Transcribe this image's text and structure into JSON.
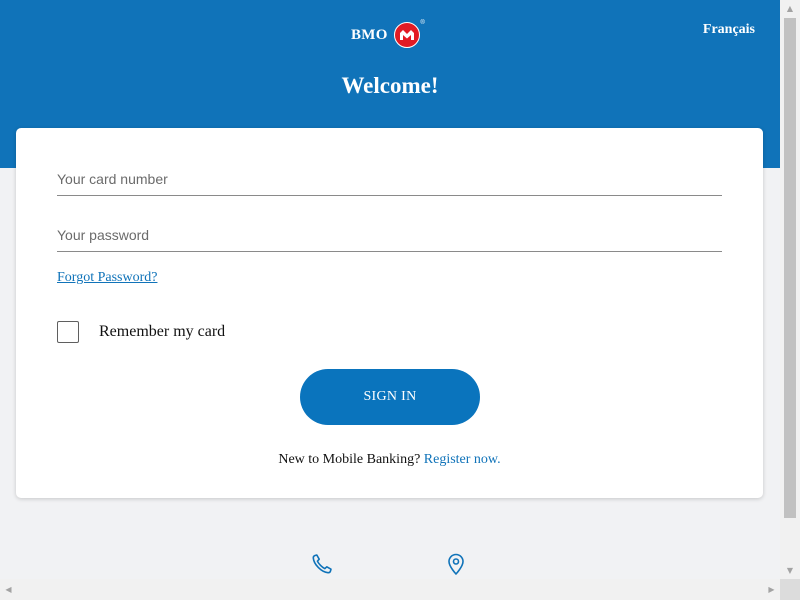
{
  "header": {
    "brand_text": "BMO",
    "brand_reg_mark": "®",
    "language_link": "Français",
    "welcome_title": "Welcome!"
  },
  "login_form": {
    "card_number": {
      "placeholder": "Your card number",
      "value": ""
    },
    "password": {
      "placeholder": "Your password",
      "value": ""
    },
    "forgot_password_link": "Forgot Password?",
    "remember_card": {
      "label": "Remember my card",
      "checked": false
    },
    "sign_in_button": "SIGN IN",
    "register_prompt": "New to Mobile Banking?",
    "register_link": "Register now."
  },
  "footer": {
    "icons": [
      "phone-icon",
      "location-pin-icon"
    ]
  },
  "icons": {
    "brand_logo": "bmo-roundel-logo",
    "scroll_up": "▲",
    "scroll_down": "▼",
    "scroll_left": "◀",
    "scroll_right": "▶"
  },
  "colors": {
    "header_blue": "#1073b9",
    "button_blue": "#0a74bd",
    "brand_red": "#e21b24",
    "page_background": "#f1f2f4",
    "card_background": "#ffffff"
  }
}
